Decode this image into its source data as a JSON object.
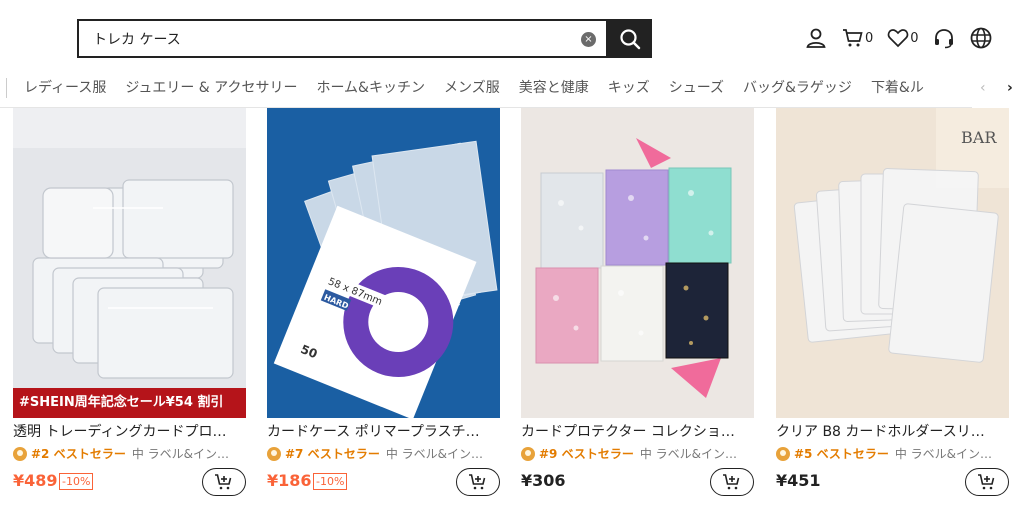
{
  "search": {
    "value": "トレカ ケース",
    "clear_label": "×"
  },
  "header": {
    "cart_count": "0",
    "wishlist_count": "0"
  },
  "categories": [
    "レディース服",
    "ジュエリー & アクセサリー",
    "ホーム&キッチン",
    "メンズ服",
    "美容と健康",
    "キッズ",
    "シューズ",
    "バッグ&ラゲッジ",
    "下着&ル"
  ],
  "nav": {
    "prev": "‹",
    "next": "›"
  },
  "products": [
    {
      "title": "透明 トレーディングカードプロ…",
      "rank": "#2 ベストセラー",
      "sub": "中 ラベル&イン…",
      "price": "¥489",
      "discount": "-10%",
      "promo": "#SHEIN周年記念セール¥54 割引"
    },
    {
      "title": "カードケース ポリマープラスチ…",
      "rank": "#7 ベストセラー",
      "sub": "中 ラベル&イン…",
      "price": "¥186",
      "discount": "-10%"
    },
    {
      "title": "カードプロテクター コレクショ…",
      "rank": "#9 ベストセラー",
      "sub": "中 ラベル&イン…",
      "price": "¥306"
    },
    {
      "title": "クリア B8 カードホルダースリ…",
      "rank": "#5 ベストセラー",
      "sub": "中 ラベル&イン…",
      "price": "¥451"
    }
  ],
  "product_images": [
    {
      "box_text": ""
    },
    {
      "box_text": "58 x 87mm",
      "box_text2": "HARD",
      "box_text3": "50"
    },
    {
      "box_text": ""
    },
    {
      "box_text": "BAR"
    }
  ],
  "colors": {
    "accent": "#fa6338",
    "rank": "#e37c00",
    "promo": "#b5141a"
  }
}
